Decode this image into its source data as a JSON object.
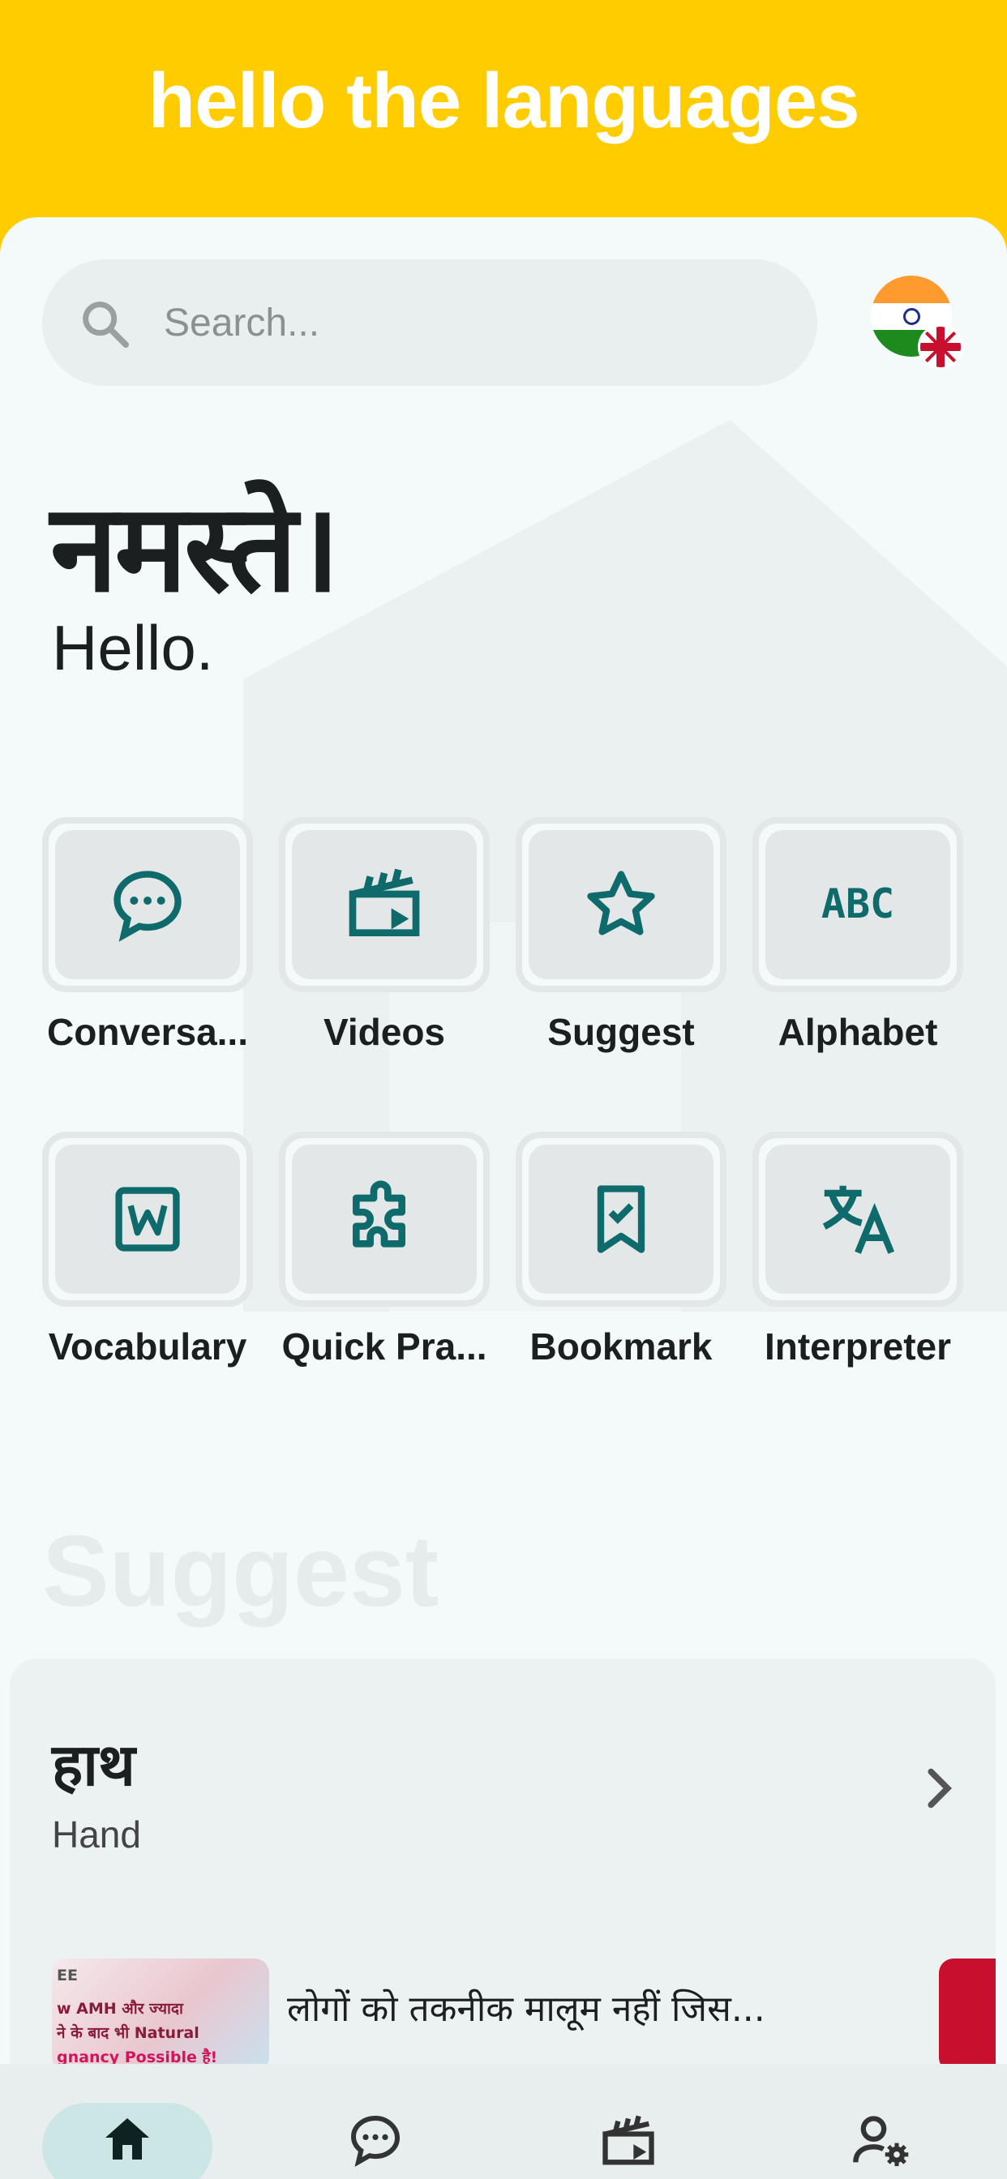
{
  "header": {
    "app_title": "hello the languages"
  },
  "search": {
    "placeholder": "Search..."
  },
  "language": {
    "source": "Hindi",
    "target": "English"
  },
  "greeting": {
    "native": "नमस्ते।",
    "translation": "Hello."
  },
  "features": [
    {
      "label": "Conversa...",
      "icon": "chat-bubble-icon"
    },
    {
      "label": "Videos",
      "icon": "clapperboard-icon"
    },
    {
      "label": "Suggest",
      "icon": "star-icon"
    },
    {
      "label": "Alphabet",
      "icon": "abc-icon"
    },
    {
      "label": "Vocabulary",
      "icon": "word-document-icon"
    },
    {
      "label": "Quick Pra...",
      "icon": "puzzle-icon"
    },
    {
      "label": "Bookmark",
      "icon": "bookmark-check-icon"
    },
    {
      "label": "Interpreter",
      "icon": "translate-icon"
    }
  ],
  "suggest": {
    "heading": "Suggest",
    "word": "हाथ",
    "word_translation": "Hand",
    "video_title": "लोगों को तकनीक मालूम नहीं जिस...",
    "thumbnail_text": [
      "EE",
      "w AMH और ज्यादा",
      "ने के बाद भी Natural",
      "gnancy Possible है!"
    ]
  },
  "bottom_nav": [
    {
      "name": "home",
      "icon": "home-icon",
      "active": true
    },
    {
      "name": "conversation",
      "icon": "chat-bubble-icon",
      "active": false
    },
    {
      "name": "videos",
      "icon": "clapperboard-icon",
      "active": false
    },
    {
      "name": "profile-settings",
      "icon": "user-settings-icon",
      "active": false
    }
  ],
  "colors": {
    "accent": "#ffcc00",
    "teal": "#0f6b6b",
    "background": "#f4f9f9"
  }
}
